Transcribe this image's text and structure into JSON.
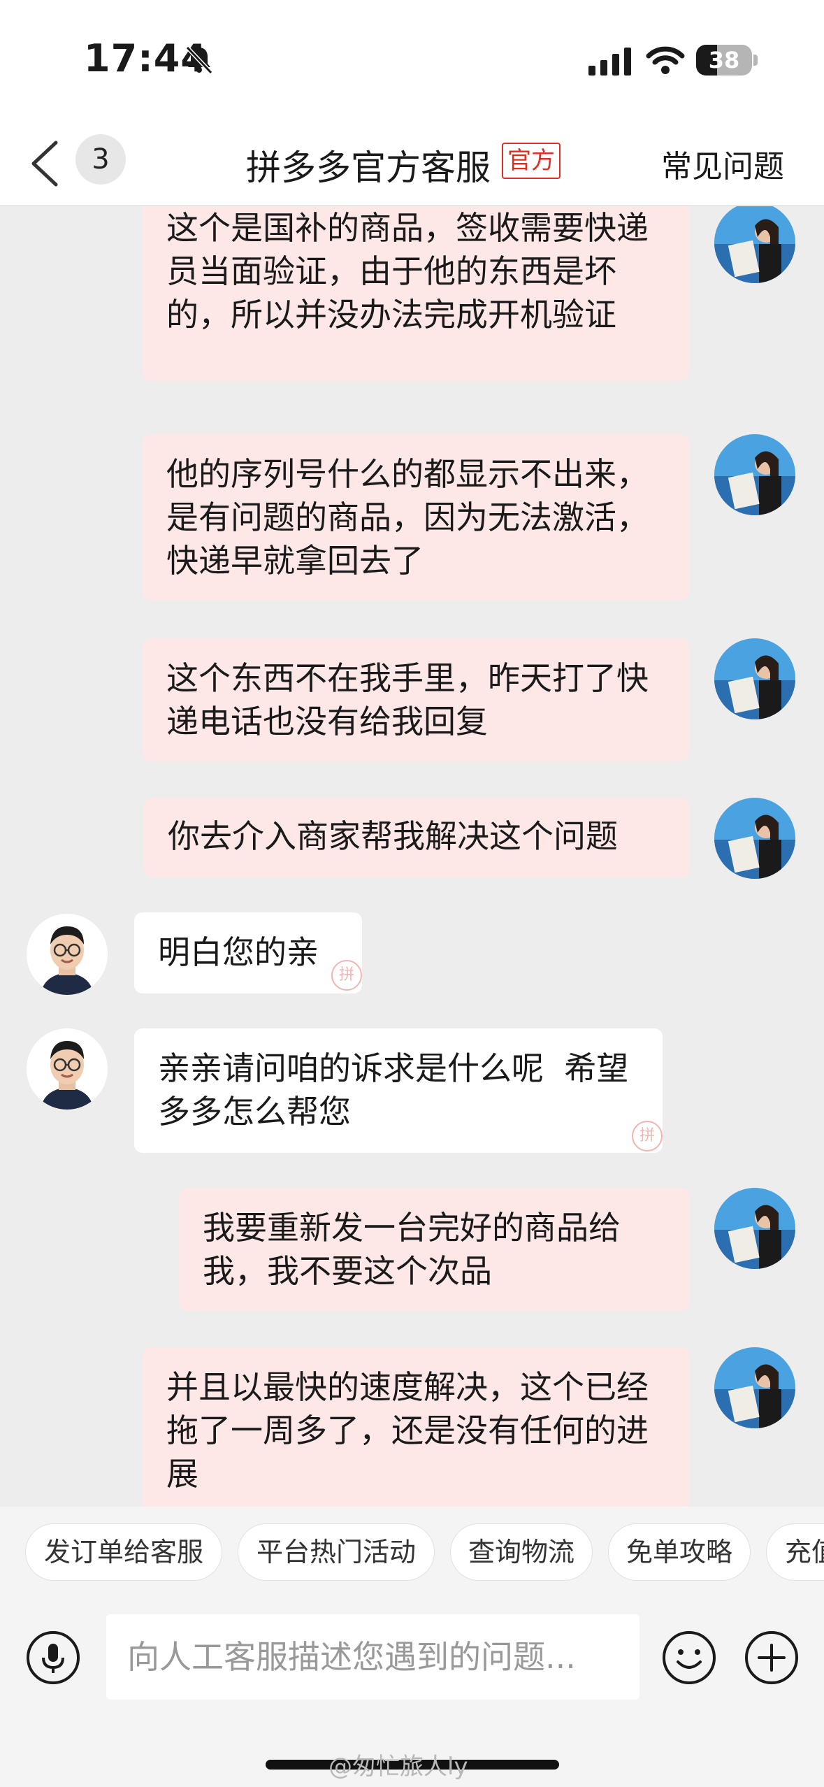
{
  "status_bar": {
    "time": "17:44",
    "battery": "38",
    "icons": [
      "bell-slash-icon",
      "cellular-signal-icon",
      "wifi-icon",
      "battery-icon"
    ]
  },
  "nav": {
    "unread_count": "3",
    "title": "拼多多官方客服",
    "official_tag": "官方",
    "faq": "常见问题"
  },
  "colors": {
    "brand_red": "#e02e24",
    "user_bubble": "#fde8e7",
    "agent_bubble": "#ffffff",
    "background": "#ededed"
  },
  "messages": [
    {
      "side": "right",
      "text": "这个是国补的商品，签收需要快递员当面验证，由于他的东西是坏的，所以并没办法完成开机验证"
    },
    {
      "side": "right",
      "text": "他的序列号什么的都显示不出来，是有问题的商品，因为无法激活，快递早就拿回去了"
    },
    {
      "side": "right",
      "text": "这个东西不在我手里，昨天打了快递电话也没有给我回复"
    },
    {
      "side": "right",
      "text": "你去介入商家帮我解决这个问题"
    },
    {
      "side": "left",
      "text": "明白您的亲"
    },
    {
      "side": "left",
      "text": "亲亲请问咱的诉求是什么呢  希望多多怎么帮您"
    },
    {
      "side": "right",
      "text": "我要重新发一台完好的商品给我，我不要这个次品"
    },
    {
      "side": "right",
      "text": "并且以最快的速度解决，这个已经拖了一周多了，还是没有任何的进展"
    }
  ],
  "quick_replies": [
    "发订单给客服",
    "平台热门活动",
    "查询物流",
    "免单攻略",
    "充值"
  ],
  "input": {
    "placeholder": "向人工客服描述您遇到的问题..."
  },
  "watermark": "@匆忙旅人ly"
}
